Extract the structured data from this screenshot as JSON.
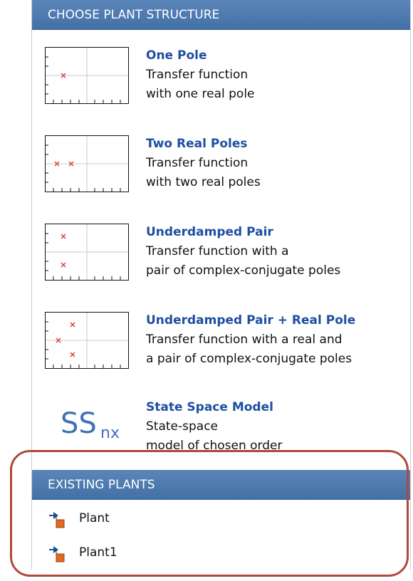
{
  "structure": {
    "header": "CHOOSE PLANT STRUCTURE",
    "items": [
      {
        "title": "One Pole",
        "line1": "Transfer function",
        "line2": "with one real pole",
        "icon": "one-pole-plot"
      },
      {
        "title": "Two Real Poles",
        "line1": "Transfer function",
        "line2": "with two real poles",
        "icon": "two-real-poles-plot"
      },
      {
        "title": "Underdamped Pair",
        "line1": "Transfer function with a",
        "line2": "pair of complex-conjugate poles",
        "icon": "underdamped-pair-plot"
      },
      {
        "title": "Underdamped Pair + Real Pole",
        "line1": "Transfer function with a real and",
        "line2": "a pair of complex-conjugate poles",
        "icon": "underdamped-pair-real-pole-plot"
      },
      {
        "title": "State Space Model",
        "line1": "State-space",
        "line2": "model of chosen order",
        "icon": "state-space-icon",
        "icon_text": "SS",
        "icon_sub": "nx"
      }
    ]
  },
  "existing": {
    "header": "EXISTING PLANTS",
    "plants": [
      {
        "label": "Plant",
        "icon": "plant-icon"
      },
      {
        "label": "Plant1",
        "icon": "plant-icon"
      }
    ]
  },
  "colors": {
    "header_bg": "#4f7bb0",
    "title": "#1e4fa0",
    "pole_marker": "#e0403a",
    "highlight_oval": "#b0493a"
  }
}
